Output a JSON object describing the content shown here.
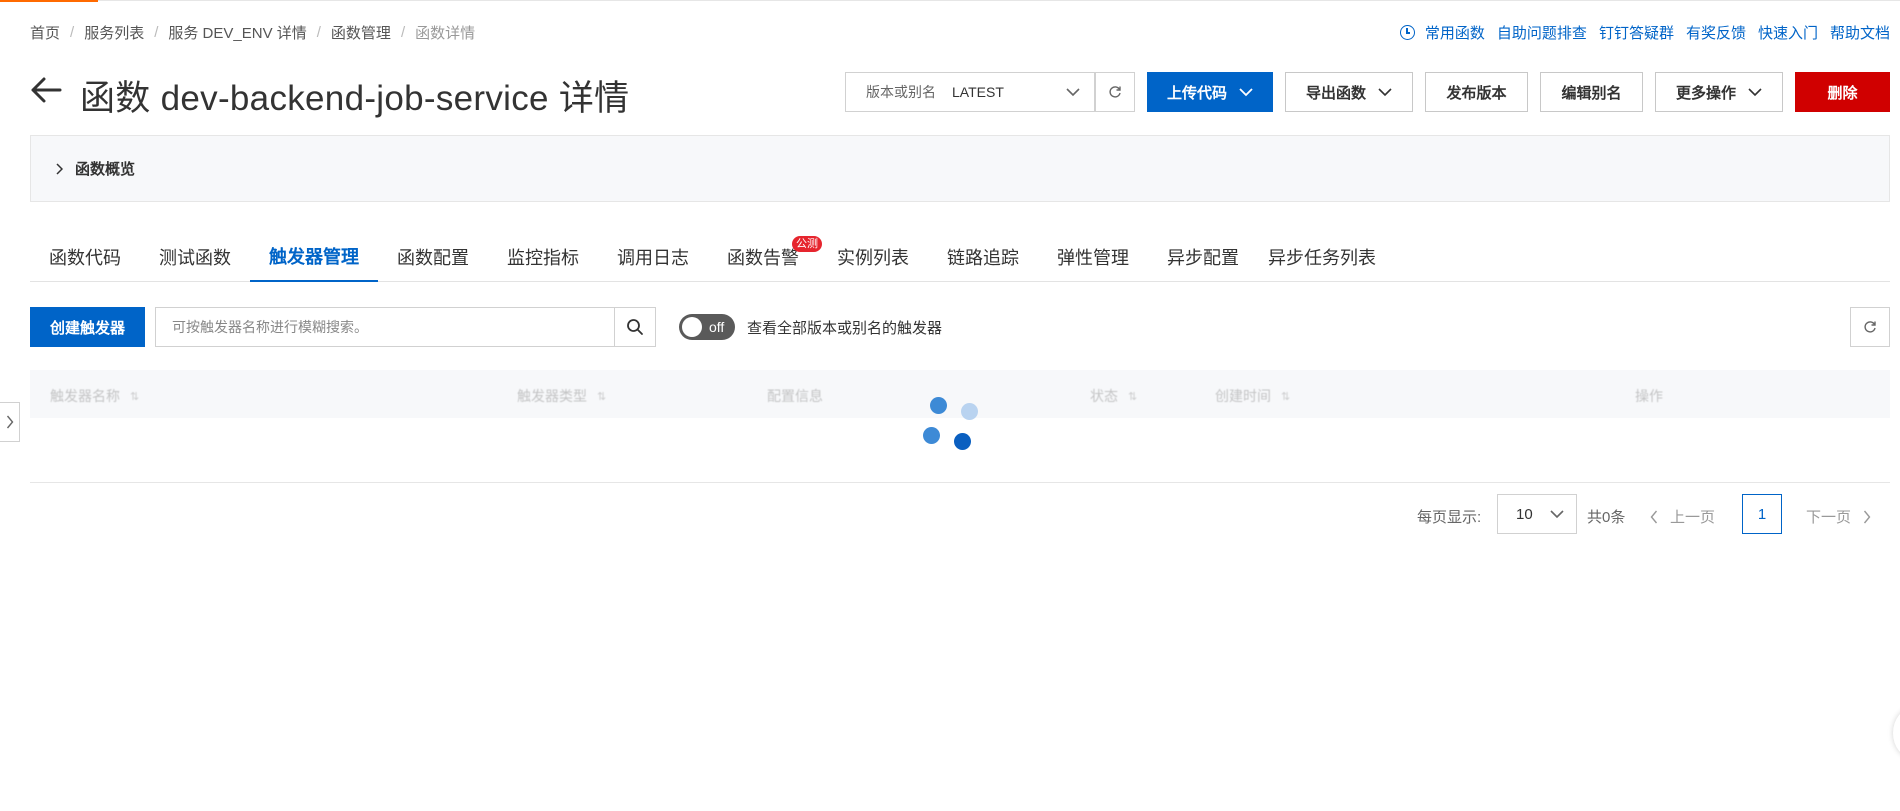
{
  "breadcrumb": [
    "首页",
    "服务列表",
    "服务 DEV_ENV 详情",
    "函数管理",
    "函数详情"
  ],
  "help_links": [
    "常用函数",
    "自助问题排查",
    "钉钉答疑群",
    "有奖反馈",
    "快速入门",
    "帮助文档"
  ],
  "title": "函数 dev-backend-job-service 详情",
  "version_select": {
    "label": "版本或别名",
    "value": "LATEST"
  },
  "actions": {
    "upload": "上传代码",
    "export": "导出函数",
    "publish": "发布版本",
    "edit_alias": "编辑别名",
    "more": "更多操作",
    "delete": "删除"
  },
  "overview": {
    "label": "函数概览"
  },
  "tabs": [
    "函数代码",
    "测试函数",
    "触发器管理",
    "函数配置",
    "监控指标",
    "调用日志",
    "函数告警",
    "实例列表",
    "链路追踪",
    "弹性管理",
    "异步配置",
    "异步任务列表"
  ],
  "active_tab": "触发器管理",
  "tab_badge": "公测",
  "toolbar": {
    "create_label": "创建触发器",
    "search_placeholder": "可按触发器名称进行模糊搜索。",
    "toggle_state": "off",
    "toggle_label": "查看全部版本或别名的触发器"
  },
  "table": {
    "columns": [
      "触发器名称",
      "触发器类型",
      "配置信息",
      "状态",
      "创建时间",
      "操作"
    ]
  },
  "pagination": {
    "per_page_label": "每页显示:",
    "per_page": "10",
    "total": "共0条",
    "prev": "上一页",
    "current": "1",
    "next": "下一页"
  },
  "colors": {
    "primary": "#0064c8",
    "danger": "#d00000",
    "accent": "#ff6a00",
    "badge": "#e6252e"
  },
  "icons": [
    "clock-icon",
    "back-arrow-icon",
    "chevron-down-icon",
    "refresh-icon",
    "chevron-right-icon",
    "search-icon",
    "sort-icon",
    "chevron-left-icon",
    "loading-spinner"
  ]
}
